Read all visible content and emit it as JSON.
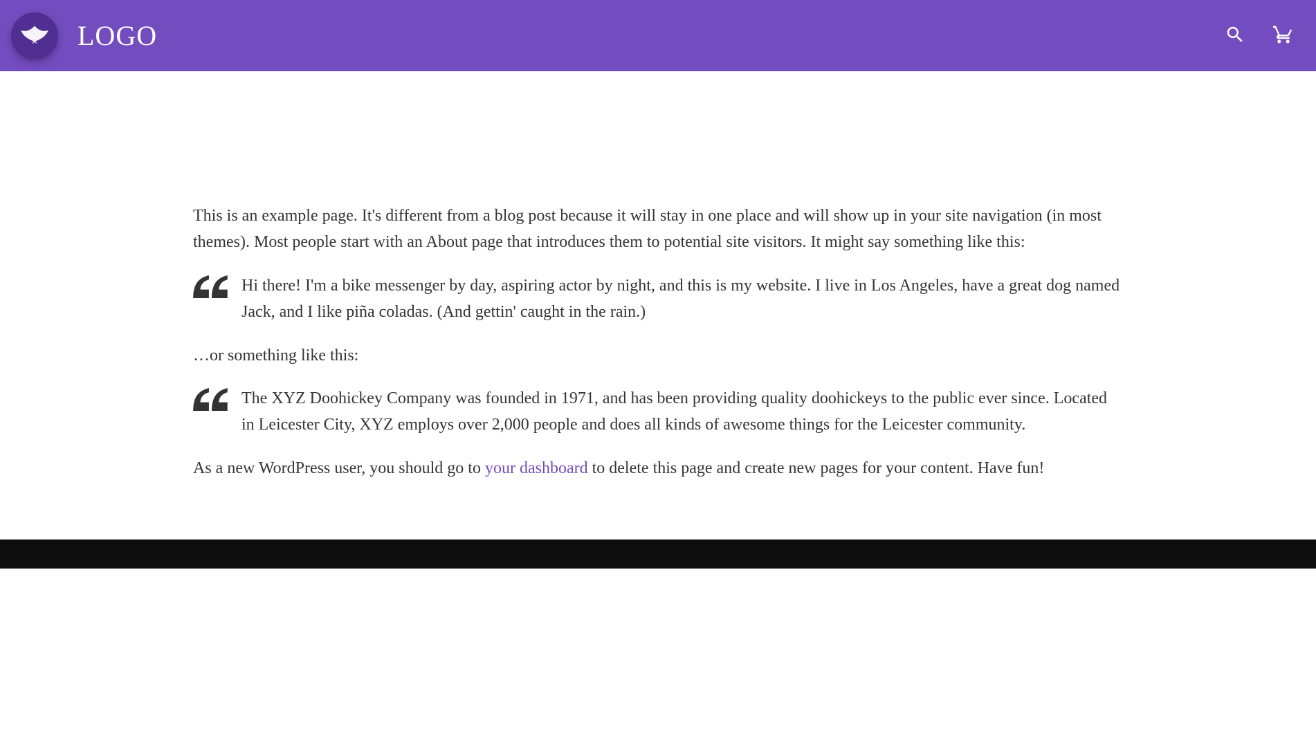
{
  "header": {
    "logo_text": "LOGO"
  },
  "page": {
    "intro": "This is an example page. It's different from a blog post because it will stay in one place and will show up in your site navigation (in most themes). Most people start with an About page that introduces them to potential site visitors. It might say something like this:",
    "quote1": "Hi there! I'm a bike messenger by day, aspiring actor by night, and this is my website. I live in Los Angeles, have a great dog named Jack, and I like piña coladas. (And gettin' caught in the rain.)",
    "middle": "…or something like this:",
    "quote2": "The XYZ Doohickey Company was founded in 1971, and has been providing quality doohickeys to the public ever since. Located in Leicester City, XYZ employs over 2,000 people and does all kinds of awesome things for the Leicester community.",
    "closing_before": "As a new WordPress user, you should go to ",
    "closing_link": "your dashboard",
    "closing_after": " to delete this page and create new pages for your content. Have fun!"
  }
}
